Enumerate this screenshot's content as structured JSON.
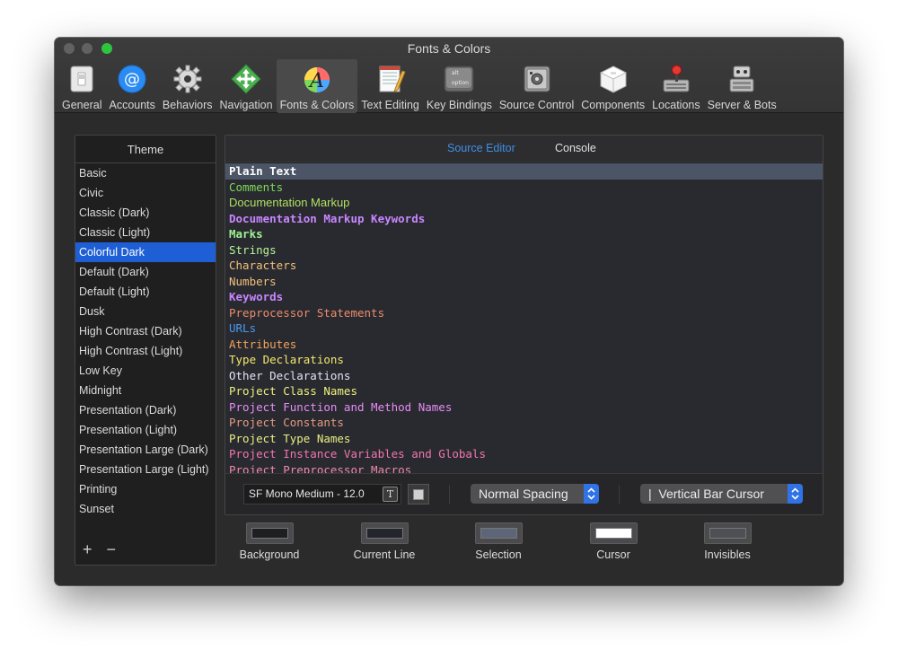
{
  "window": {
    "title": "Fonts & Colors"
  },
  "toolbar": [
    {
      "label": "General",
      "icon": "general-switch-icon"
    },
    {
      "label": "Accounts",
      "icon": "at-sign-icon"
    },
    {
      "label": "Behaviors",
      "icon": "gear-icon"
    },
    {
      "label": "Navigation",
      "icon": "navigation-arrows-icon"
    },
    {
      "label": "Fonts & Colors",
      "icon": "font-palette-icon"
    },
    {
      "label": "Text Editing",
      "icon": "notepad-pencil-icon"
    },
    {
      "label": "Key Bindings",
      "icon": "keyboard-keys-icon"
    },
    {
      "label": "Source Control",
      "icon": "safe-icon"
    },
    {
      "label": "Components",
      "icon": "cube-box-icon"
    },
    {
      "label": "Locations",
      "icon": "joystick-drive-icon"
    },
    {
      "label": "Server & Bots",
      "icon": "server-robot-icon"
    }
  ],
  "toolbar_key_labels": {
    "top": "alt",
    "bottom": "option"
  },
  "themes": {
    "header": "Theme",
    "items": [
      "Basic",
      "Civic",
      "Classic (Dark)",
      "Classic (Light)",
      "Colorful Dark",
      "Default (Dark)",
      "Default (Light)",
      "Dusk",
      "High Contrast (Dark)",
      "High Contrast (Light)",
      "Low Key",
      "Midnight",
      "Presentation (Dark)",
      "Presentation (Light)",
      "Presentation Large (Dark)",
      "Presentation Large (Light)",
      "Printing",
      "Sunset"
    ],
    "selected": "Colorful Dark",
    "add_label": "+",
    "remove_label": "−"
  },
  "editor": {
    "tabs": [
      "Source Editor",
      "Console"
    ],
    "active_tab": "Source Editor",
    "syntax_items": [
      {
        "label": "Plain Text",
        "color": "#ffffff",
        "bold": true,
        "selected": true
      },
      {
        "label": "Comments",
        "color": "#7ed957",
        "bold": false
      },
      {
        "label": "Documentation Markup",
        "color": "#b0e060",
        "bold": false,
        "proportional": true
      },
      {
        "label": "Documentation Markup Keywords",
        "color": "#c986ff",
        "bold": true
      },
      {
        "label": "Marks",
        "color": "#9ff291",
        "bold": true
      },
      {
        "label": "Strings",
        "color": "#b6f59a",
        "bold": false
      },
      {
        "label": "Characters",
        "color": "#f2c07a",
        "bold": false
      },
      {
        "label": "Numbers",
        "color": "#f2c07a",
        "bold": false
      },
      {
        "label": "Keywords",
        "color": "#c986ff",
        "bold": true
      },
      {
        "label": "Preprocessor Statements",
        "color": "#ee8c6a",
        "bold": false
      },
      {
        "label": "URLs",
        "color": "#4a98f0",
        "bold": false
      },
      {
        "label": "Attributes",
        "color": "#f0a35a",
        "bold": false
      },
      {
        "label": "Type Declarations",
        "color": "#f2e86a",
        "bold": false
      },
      {
        "label": "Other Declarations",
        "color": "#e4e4f4",
        "bold": false
      },
      {
        "label": "Project Class Names",
        "color": "#eef07a",
        "bold": false
      },
      {
        "label": "Project Function and Method Names",
        "color": "#e88bf5",
        "bold": false
      },
      {
        "label": "Project Constants",
        "color": "#e69a82",
        "bold": false
      },
      {
        "label": "Project Type Names",
        "color": "#e9ee80",
        "bold": false
      },
      {
        "label": "Project Instance Variables and Globals",
        "color": "#f276b0",
        "bold": false
      },
      {
        "label": "Project Preprocessor Macros",
        "color": "#f288a8",
        "bold": false
      }
    ],
    "font": "SF Mono Medium - 12.0",
    "font_button": "T",
    "spacing": "Normal Spacing",
    "cursor": "|  Vertical Bar Cursor"
  },
  "swatches": [
    {
      "label": "Background",
      "color": "#1e1f22"
    },
    {
      "label": "Current Line",
      "color": "#24262d"
    },
    {
      "label": "Selection",
      "color": "#5d6679"
    },
    {
      "label": "Cursor",
      "color": "#ffffff"
    },
    {
      "label": "Invisibles",
      "color": "#4d4f54"
    }
  ]
}
